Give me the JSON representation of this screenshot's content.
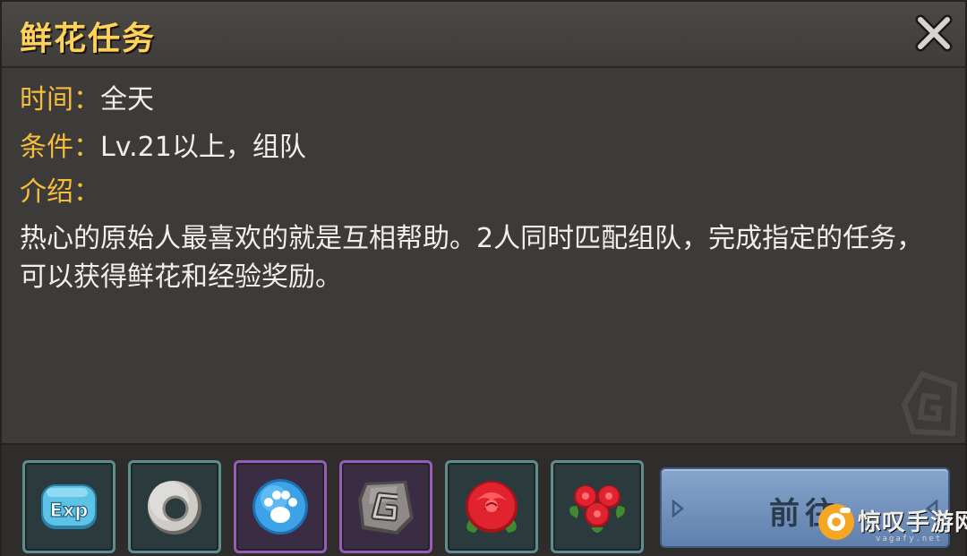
{
  "dialog": {
    "title": "鲜花任务",
    "close_icon": "close-icon"
  },
  "info": {
    "time_label": "时间：",
    "time_value": "全天",
    "condition_label": "条件：",
    "condition_value": "Lv.21以上，组队",
    "intro_label": "介绍：",
    "intro_text": "热心的原始人最喜欢的就是互相帮助。2人同时匹配组队，完成指定的任务，可以获得鲜花和经验奖励。"
  },
  "rewards": [
    {
      "icon": "exp-icon",
      "text": "Exp",
      "frame": "teal"
    },
    {
      "icon": "stone-ring-icon",
      "frame": "teal"
    },
    {
      "icon": "blue-paw-icon",
      "frame": "purple"
    },
    {
      "icon": "g-stone-icon",
      "frame": "purple"
    },
    {
      "icon": "red-rose-icon",
      "frame": "teal"
    },
    {
      "icon": "rose-bouquet-icon",
      "frame": "teal"
    }
  ],
  "go_button": {
    "label": "前往"
  },
  "watermark": {
    "text": "惊叹手游网",
    "domain": "vagafy.net"
  },
  "colors": {
    "title": "#ffd25a",
    "label": "#f6bc3c",
    "text": "#f2efe9",
    "panel": "#3d3b39",
    "button": "#7393bd"
  }
}
